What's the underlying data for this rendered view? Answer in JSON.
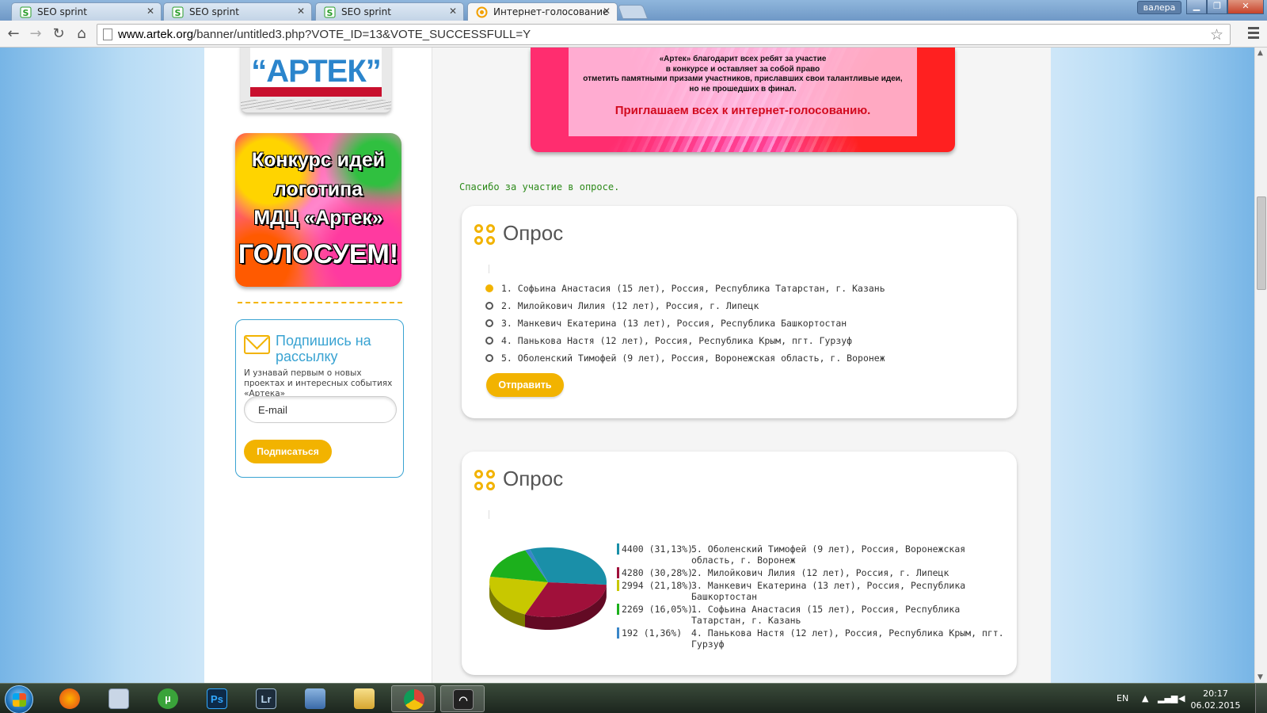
{
  "browser": {
    "tabs": [
      {
        "label": "SEO sprint",
        "active": false
      },
      {
        "label": "SEO sprint",
        "active": false
      },
      {
        "label": "SEO sprint",
        "active": false
      },
      {
        "label": "Интернет-голосование",
        "active": true
      }
    ],
    "user_badge": "валера",
    "url_host": "www.artek.org",
    "url_path": "/banner/untitled3.php?VOTE_ID=13&VOTE_SUCCESSFULL=Y",
    "icons": [
      "back-arrow-icon",
      "forward-arrow-icon",
      "reload-icon",
      "home-icon",
      "star-icon",
      "menu-icon"
    ]
  },
  "sidebar": {
    "stamp_text": "“АРТЕК”",
    "contest_banner": {
      "line1": "Конкурс идей",
      "line2": "логотипа",
      "line3": "МДЦ «Артек»",
      "line4": "ГОЛОСУЕМ!"
    },
    "subscribe": {
      "title": "Подпишись на рассылку",
      "description": "И узнавай первым о новых проектах и интересных событиях «Артека»",
      "email_placeholder": "E-mail",
      "button_label": "Подписаться"
    }
  },
  "hero": {
    "line1": "«Артек» благодарит всех ребят за участие",
    "line2": "в конкурсе и оставляет за собой право",
    "line3": "отметить памятными призами участников, приславших свои талантливые идеи,",
    "line4": "но не прошедших в финал.",
    "cta": "Приглашаем всех к интернет-голосованию."
  },
  "thanks_message": "Спасибо за участие в опросе.",
  "vote_poll": {
    "title": "Опрос",
    "options": [
      {
        "label": "1. Софьина Анастасия (15 лет), Россия, Республика Татарстан, г. Казань",
        "checked": true
      },
      {
        "label": "2. Милойкович Лилия (12 лет), Россия, г. Липецк",
        "checked": false
      },
      {
        "label": "3. Манкевич Екатерина (13 лет), Россия, Республика Башкортостан",
        "checked": false
      },
      {
        "label": "4. Панькова Настя (12 лет), Россия, Республика Крым, пгт. Гурзуф",
        "checked": false
      },
      {
        "label": "5. Оболенский Тимофей (9 лет), Россия, Воронежская область, г. Воронеж",
        "checked": false
      }
    ],
    "submit_label": "Отправить"
  },
  "results_poll": {
    "title": "Опрос",
    "rows": [
      {
        "value_text": "4400 (31,13%)",
        "name": "5. Оболенский Тимофей (9 лет), Россия, Воронежская область, г. Воронеж",
        "color": "#1a8fa8"
      },
      {
        "value_text": "4280 (30,28%)",
        "name": "2. Милойкович Лилия (12 лет), Россия, г. Липецк",
        "color": "#a0103a"
      },
      {
        "value_text": "2994 (21,18%)",
        "name": "3. Манкевич Екатерина (13 лет), Россия, Республика Башкортостан",
        "color": "#c8c800"
      },
      {
        "value_text": "2269 (16,05%)",
        "name": "1. Софьина Анастасия (15 лет), Россия, Республика Татарстан, г. Казань",
        "color": "#1cb01c"
      },
      {
        "value_text": "192 (1,36%)",
        "name": "4. Панькова Настя (12 лет), Россия, Республика Крым, пгт. Гурзуф",
        "color": "#3a86c8"
      }
    ]
  },
  "chart_data": {
    "type": "pie",
    "categories": [
      "5. Оболенский Тимофей (9 лет), Россия, Воронежская область, г. Воронеж",
      "2. Милойкович Лилия (12 лет), Россия, г. Липецк",
      "3. Манкевич Екатерина (13 лет), Россия, Республика Башкортостан",
      "1. Софьина Анастасия (15 лет), Россия, Республика Татарстан, г. Казань",
      "4. Панькова Настя (12 лет), Россия, Республика Крым, пгт. Гурзуф"
    ],
    "values": [
      4400,
      4280,
      2994,
      2269,
      192
    ],
    "percent": [
      31.13,
      30.28,
      21.18,
      16.05,
      1.36
    ],
    "colors": [
      "#1a8fa8",
      "#a0103a",
      "#c8c800",
      "#1cb01c",
      "#3a86c8"
    ],
    "legend_position": "right"
  },
  "taskbar": {
    "apps": [
      {
        "icon": "firefox-icon"
      },
      {
        "icon": "calculator-icon"
      },
      {
        "icon": "utorrent-icon",
        "glyph": "µ"
      },
      {
        "icon": "photoshop-icon",
        "glyph": "Ps"
      },
      {
        "icon": "lightroom-icon",
        "glyph": "Lr"
      },
      {
        "icon": "network-icon"
      },
      {
        "icon": "folder-icon"
      },
      {
        "icon": "chrome-icon",
        "active": true
      },
      {
        "icon": "wifi-icon",
        "active": true
      }
    ],
    "language": "EN",
    "time": "20:17",
    "date": "06.02.2015"
  }
}
